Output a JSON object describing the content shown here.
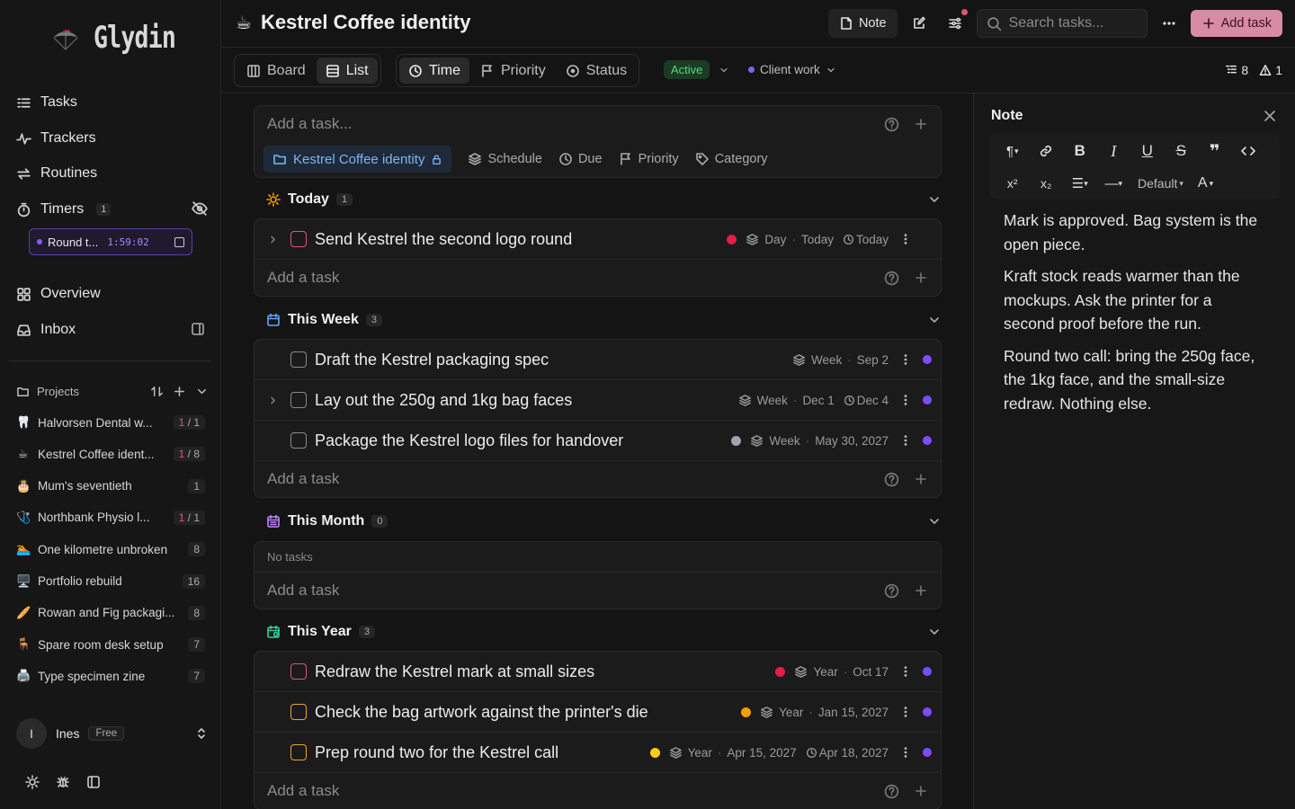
{
  "app": {
    "name": "Glydin"
  },
  "nav": {
    "tasks": "Tasks",
    "trackers": "Trackers",
    "routines": "Routines",
    "timers": "Timers",
    "timers_count": "1",
    "overview": "Overview",
    "inbox": "Inbox"
  },
  "timer_chip": {
    "label": "Round t...",
    "time": "1:59:02"
  },
  "projects": {
    "header": "Projects",
    "items": [
      {
        "emoji": "🦷",
        "name": "Halvorsen Dental w...",
        "done": "1",
        "total": "1"
      },
      {
        "emoji": "☕",
        "name": "Kestrel Coffee ident...",
        "done": "1",
        "total": "8"
      },
      {
        "emoji": "🎂",
        "name": "Mum's seventieth",
        "done": "",
        "total": "1"
      },
      {
        "emoji": "🩺",
        "name": "Northbank Physio l...",
        "done": "1",
        "total": "1"
      },
      {
        "emoji": "🏊",
        "name": "One kilometre unbroken",
        "done": "",
        "total": "8"
      },
      {
        "emoji": "🖥️",
        "name": "Portfolio rebuild",
        "done": "",
        "total": "16"
      },
      {
        "emoji": "🥖",
        "name": "Rowan and Fig packagi...",
        "done": "",
        "total": "8"
      },
      {
        "emoji": "🪑",
        "name": "Spare room desk setup",
        "done": "",
        "total": "7"
      },
      {
        "emoji": "🖨️",
        "name": "Type specimen zine",
        "done": "",
        "total": "7"
      }
    ]
  },
  "user": {
    "initial": "I",
    "name": "Ines",
    "plan": "Free"
  },
  "header": {
    "emoji": "☕",
    "title": "Kestrel Coffee identity",
    "note_label": "Note",
    "search_placeholder": "Search tasks...",
    "add_task_label": "Add task"
  },
  "views": {
    "board": "Board",
    "list": "List",
    "time": "Time",
    "priority": "Priority",
    "status": "Status"
  },
  "filters": {
    "status": "Active",
    "category": "Client work"
  },
  "stats": {
    "subtasks": "8",
    "warnings": "1"
  },
  "composer": {
    "placeholder": "Add a task...",
    "project": "Kestrel Coffee identity",
    "schedule": "Schedule",
    "due": "Due",
    "priority": "Priority",
    "category": "Category"
  },
  "sections": {
    "today": {
      "label": "Today",
      "count": "1",
      "tasks": [
        {
          "title": "Send Kestrel the second logo round",
          "period": "Day",
          "date": "Today",
          "due": "Today",
          "priority_color": "#e11d48",
          "check": "red"
        }
      ]
    },
    "week": {
      "label": "This Week",
      "count": "3",
      "tasks": [
        {
          "title": "Draft the Kestrel packaging spec",
          "period": "Week",
          "date": "Sep 2",
          "due": ""
        },
        {
          "title": "Lay out the 250g and 1kg bag faces",
          "period": "Week",
          "date": "Dec 1",
          "due": "Dec 4"
        },
        {
          "title": "Package the Kestrel logo files for handover",
          "period": "Week",
          "date": "May 30, 2027",
          "due": "",
          "priority_color": "#9ca3af"
        }
      ]
    },
    "month": {
      "label": "This Month",
      "count": "0",
      "empty": "No tasks"
    },
    "year": {
      "label": "This Year",
      "count": "3",
      "tasks": [
        {
          "title": "Redraw the Kestrel mark at small sizes",
          "period": "Year",
          "date": "Oct 17",
          "due": "",
          "priority_color": "#e11d48"
        },
        {
          "title": "Check the bag artwork against the printer's die",
          "period": "Year",
          "date": "Jan 15, 2027",
          "due": "",
          "priority_color": "#f59e0b"
        },
        {
          "title": "Prep round two for the Kestrel call",
          "period": "Year",
          "date": "Apr 15, 2027",
          "due": "Apr 18, 2027",
          "priority_color": "#facc15"
        }
      ]
    },
    "add_task": "Add a task"
  },
  "note": {
    "title": "Note",
    "style_label": "Default",
    "font_label": "A",
    "paragraphs": [
      "Mark is approved. Bag system is the open piece.",
      "Kraft stock reads warmer than the mockups. Ask the printer for a second proof before the run.",
      "Round two call: bring the 250g face, the 1kg face, and the small-size redraw. Nothing else."
    ]
  }
}
